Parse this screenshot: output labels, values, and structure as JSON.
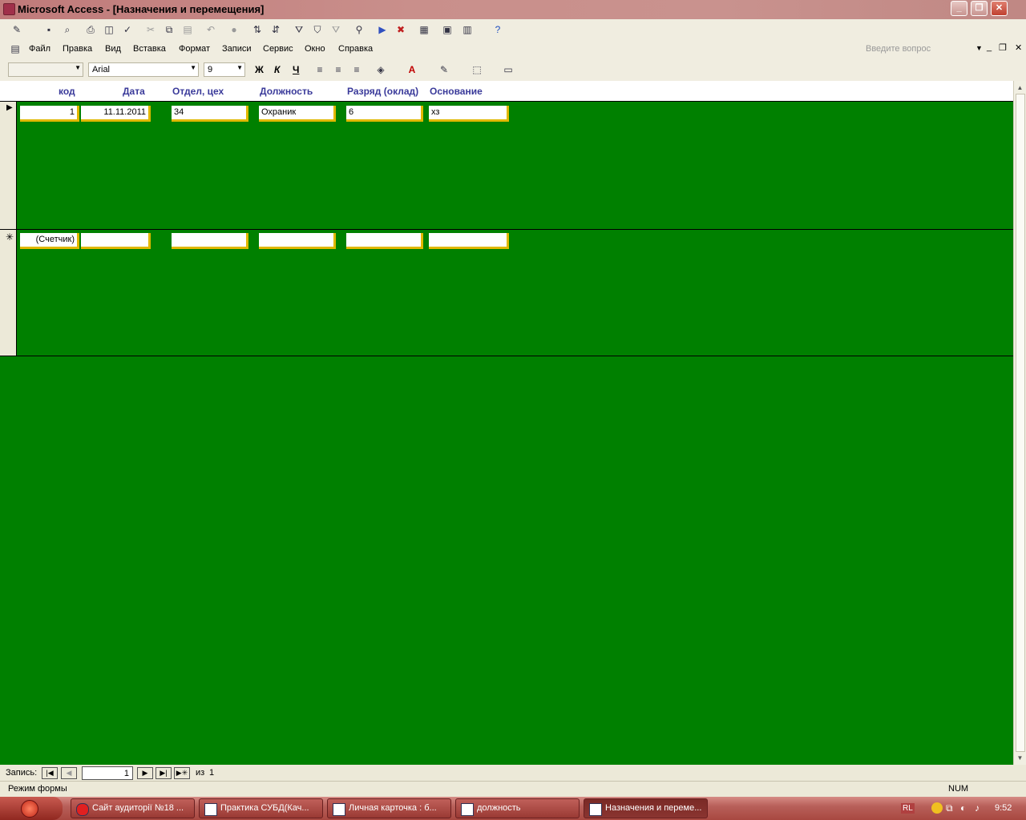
{
  "window": {
    "title": "Microsoft Access - [Назначения и перемещения]"
  },
  "menu": {
    "items": [
      "Файл",
      "Правка",
      "Вид",
      "Вставка",
      "Формат",
      "Записи",
      "Сервис",
      "Окно",
      "Справка"
    ],
    "help_placeholder": "Введите вопрос"
  },
  "format_toolbar": {
    "object_combo": "",
    "font": "Arial",
    "size": "9",
    "bold": "Ж",
    "italic": "К",
    "underline": "Ч"
  },
  "form": {
    "columns": [
      "код",
      "Дата",
      "Отдел, цех",
      "Должность",
      "Разряд (оклад)",
      "Основание"
    ],
    "rows": [
      {
        "marker": "▶",
        "kod": "1",
        "data": "11.11.2011",
        "otdel": "34",
        "dolzhnost": "Охраник",
        "razryad": "6",
        "osnovanie": "хз"
      },
      {
        "marker": "✳",
        "kod": "(Счетчик)",
        "data": "",
        "otdel": "",
        "dolzhnost": "",
        "razryad": "",
        "osnovanie": ""
      }
    ]
  },
  "navigation": {
    "label": "Запись:",
    "current": "1",
    "of_label": "из",
    "total": "1"
  },
  "status": {
    "mode": "Режим формы",
    "num": "NUM"
  },
  "taskbar": {
    "tasks": [
      "Сайт аудиторії №18 ...",
      "Практика СУБД(Кач...",
      "Личная карточка : б...",
      "должность",
      "Назначения и переме..."
    ],
    "lang": "RL",
    "time": "9:52"
  },
  "colors": {
    "form_bg": "#008000",
    "field_shadow": "#e0b800",
    "header_text": "#3a3a9a"
  }
}
